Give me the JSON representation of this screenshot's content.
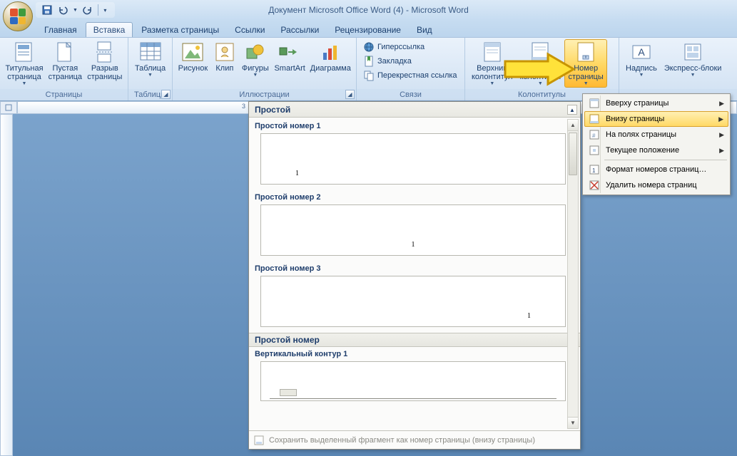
{
  "title": "Документ Microsoft Office Word (4) - Microsoft Word",
  "tabs": {
    "home": "Главная",
    "insert": "Вставка",
    "page_layout": "Разметка страницы",
    "references": "Ссылки",
    "mailings": "Рассылки",
    "review": "Рецензирование",
    "view": "Вид"
  },
  "ribbon": {
    "pages": {
      "group_label": "Страницы",
      "cover_page": "Титульная\nстраница",
      "blank_page": "Пустая\nстраница",
      "page_break": "Разрыв\nстраницы"
    },
    "tables": {
      "group_label": "Таблицы",
      "table": "Таблица"
    },
    "illustrations": {
      "group_label": "Иллюстрации",
      "picture": "Рисунок",
      "clip": "Клип",
      "shapes": "Фигуры",
      "smartart": "SmartArt",
      "chart": "Диаграмма"
    },
    "links": {
      "group_label": "Связи",
      "hyperlink": "Гиперссылка",
      "bookmark": "Закладка",
      "cross_ref": "Перекрестная ссылка"
    },
    "header_footer": {
      "group_label": "Колонтитулы",
      "header": "Верхний\nколонтитул",
      "footer": "Нижний\nколонтитул",
      "page_number": "Номер\nстраницы"
    },
    "text": {
      "wordart": "Надпись",
      "quick_parts": "Экспресс-блоки"
    }
  },
  "dropdown": {
    "top_of_page": "Вверху страницы",
    "bottom_of_page": "Внизу страницы",
    "page_margins": "На полях страницы",
    "current_position": "Текущее положение",
    "format_numbers": "Формат номеров страниц…",
    "remove_numbers": "Удалить номера страниц"
  },
  "gallery": {
    "header_simple": "Простой",
    "item1": "Простой номер 1",
    "item2": "Простой номер 2",
    "item3": "Простой номер 3",
    "header_simple_number": "Простой номер",
    "item_vertical": "Вертикальный контур 1",
    "sample_number": "1",
    "footer_save": "Сохранить выделенный фрагмент как номер страницы (внизу страницы)"
  },
  "ruler_marker": "3"
}
